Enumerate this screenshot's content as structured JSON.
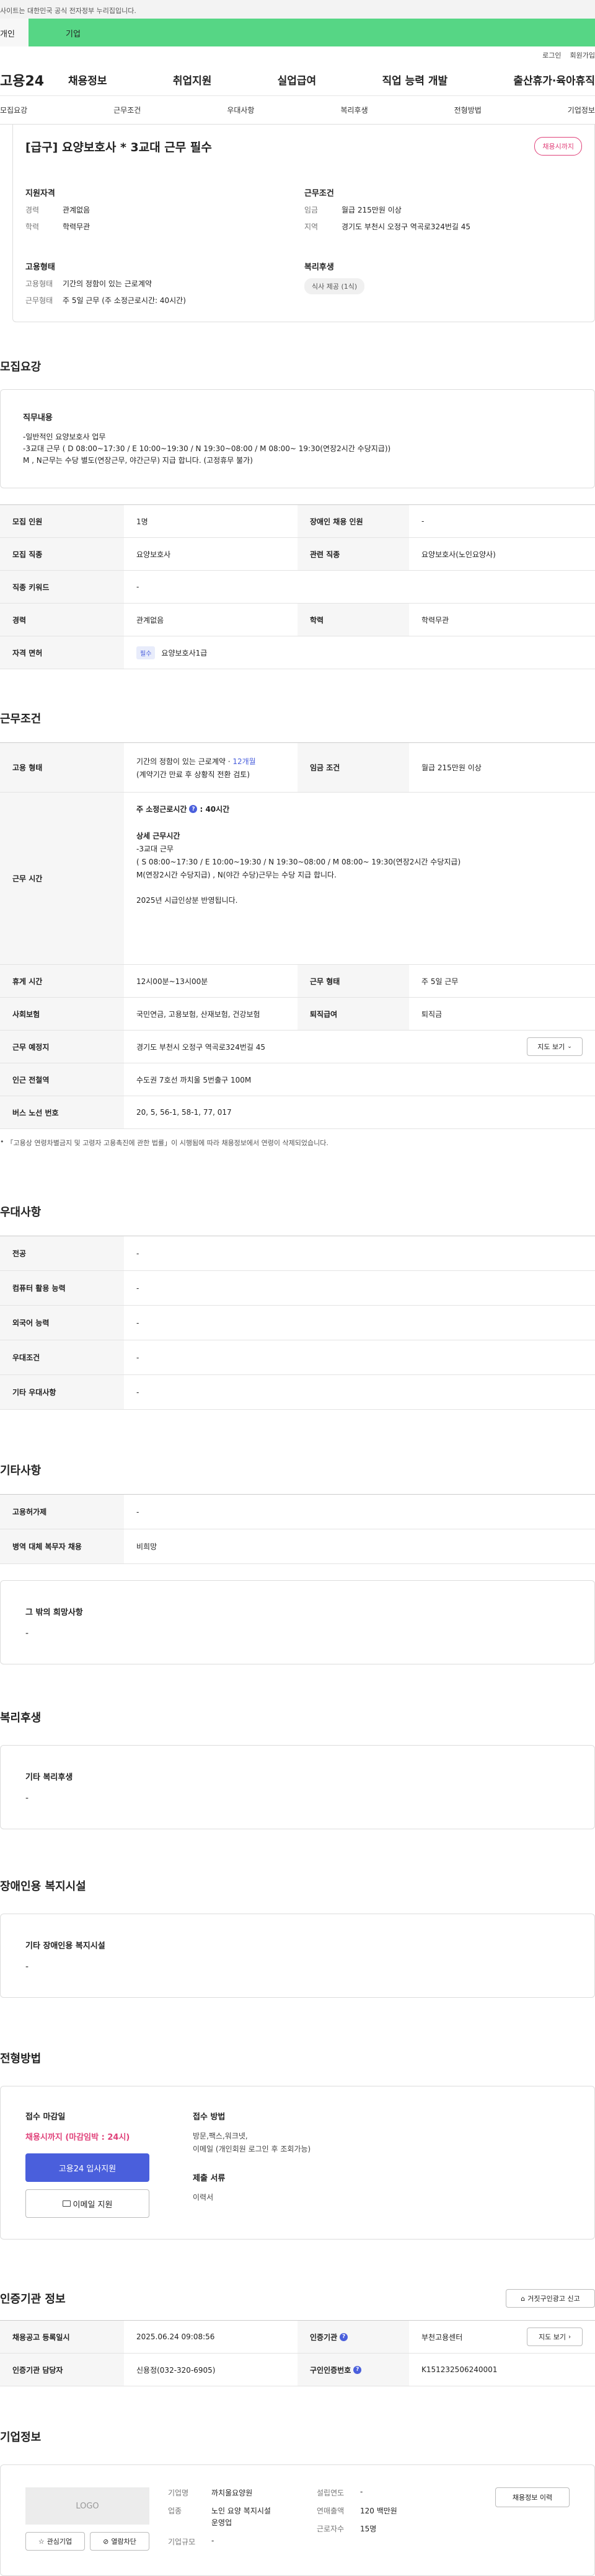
{
  "gov_notice": "사이트는 대한민국 공식 전자정부 누리집입니다.",
  "member_tabs": [
    "개인",
    "기업"
  ],
  "util_links": [
    "로그인",
    "회원가입"
  ],
  "logo": "고용24",
  "gnb": [
    "채용정보",
    "취업지원",
    "실업급여",
    "직업 능력 개발",
    "출산휴가·육아휴직"
  ],
  "anchors": [
    "모집요강",
    "근무조건",
    "우대사항",
    "복리후생",
    "전형방법",
    "기업정보"
  ],
  "summary": {
    "title": "[급구] 요양보호사 * 3교대 근무 필수",
    "badge": "채용시까지",
    "qual_title": "지원자격",
    "qual": [
      {
        "k": "경력",
        "v": "관계없음"
      },
      {
        "k": "학력",
        "v": "학력무관"
      }
    ],
    "cond_title": "근무조건",
    "cond": [
      {
        "k": "임금",
        "v": "월급 215만원 이상"
      },
      {
        "k": "지역",
        "v": "경기도 부천시 오정구 역곡로324번길 45"
      }
    ],
    "emp_title": "고용형태",
    "emp": [
      {
        "k": "고용형태",
        "v": "기간의 정함이 있는 근로계약"
      },
      {
        "k": "근무형태",
        "v": "주 5일 근무 (주 소정근로시간: 40시간)"
      }
    ],
    "welfare_title": "복리후생",
    "welfare_chip": "식사 제공 (1식)"
  },
  "recruit": {
    "title": "모집요강",
    "job_title": "직무내용",
    "job_lines": [
      "-일반적인 요양보호사 업무",
      "-3교대 근무 ( D 08:00~17:30 / E 10:00~19:30 / N 19:30~08:00 / M 08:00~ 19:30(연장2시간 수당지급))",
      "M , N근무는 수당 별도(연장근무, 야간근무) 지급 합니다. (고정휴무 불가)"
    ],
    "rows": [
      {
        "k1": "모집 인원",
        "v1": "1명",
        "k2": "장애인 채용 인원",
        "v2": "-"
      },
      {
        "k1": "모집 직종",
        "v1": "요양보호사",
        "k2": "관련 직종",
        "v2": "요양보호사(노인요양사)"
      },
      {
        "k1": "직종 키워드",
        "v1": "-",
        "k2": "",
        "v2": ""
      },
      {
        "k1": "경력",
        "v1": "관계없음",
        "k2": "학력",
        "v2": "학력무관"
      },
      {
        "k1": "자격 면허",
        "v1": "요양보호사1급",
        "k2": "",
        "v2": ""
      }
    ],
    "license_tag": "필수"
  },
  "work": {
    "title": "근무조건",
    "emp_k": "고용 형태",
    "emp_v1": "기간의 정함이 있는 근로계약 · ",
    "emp_v1_hl": "12개월",
    "emp_v2": "(계약기간 만료 후 상황직 전환 검토)",
    "wage_k": "임금 조건",
    "wage_v": "월급 215만원 이상",
    "time_k": "근무 시간",
    "time_a": "주 소정근로시간",
    "time_b": ": 40시간",
    "time_detail_title": "상세 근무시간",
    "time_lines": [
      "-3교대 근무",
      "( S 08:00~17:30 / E 10:00~19:30 / N 19:30~08:00 / M 08:00~ 19:30(연장2시간 수당지급)",
      " M(연장2시간 수당지급) , N(야간 수당)근무는 수당 지급 합니다."
    ],
    "time_note": "2025년 시급인상분 반영됩니다.",
    "rows": [
      {
        "k1": "휴게 시간",
        "v1": "12시00분~13시00분",
        "k2": "근무 형태",
        "v2": "주 5일 근무"
      },
      {
        "k1": "사회보험",
        "v1": "국민연금, 고용보험, 산재보험, 건강보험",
        "k2": "퇴직급여",
        "v2": "퇴직금"
      }
    ],
    "place_k": "근무 예정지",
    "place_v": "경기도 부천시 오정구 역곡로324번길 45",
    "map_btn": "지도 보기",
    "subway_k": "인근 전철역",
    "subway_v": "수도권 7호선 까치울 5번출구 100M",
    "bus_k": "버스 노선 번호",
    "bus_v": "20, 5, 56-1, 58-1, 77, 017",
    "footnote": "「고용상 연령차별금지 및 고령자 고용촉진에 관한 법률」이 시행됨에 따라 채용정보에서 연령이 삭제되었습니다."
  },
  "pref": {
    "title": "우대사항",
    "rows": [
      {
        "k": "전공",
        "v": "-"
      },
      {
        "k": "컴퓨터 활용 능력",
        "v": "-"
      },
      {
        "k": "외국어 능력",
        "v": "-"
      },
      {
        "k": "우대조건",
        "v": "-"
      },
      {
        "k": "기타 우대사항",
        "v": "-"
      }
    ]
  },
  "etc": {
    "title": "기타사항",
    "rows": [
      {
        "k": "고용허가제",
        "v": "-"
      },
      {
        "k": "병역 대체 복무자 채용",
        "v": "비희망"
      }
    ],
    "box_title": "그 밖의 희망사항",
    "box_v": "-"
  },
  "benefit": {
    "title": "복리후생",
    "box_title": "기타 복리후생",
    "box_v": "-"
  },
  "disabled": {
    "title": "장애인용 복지시설",
    "box_title": "기타 장애인용 복지시설",
    "box_v": "-"
  },
  "process": {
    "title": "전형방법",
    "deadline_title": "접수 마감일",
    "deadline_v": "채용시까지 (마감임박 : 24시)",
    "apply_btn": "고용24 입사지원",
    "email_btn": "이메일 지원",
    "method_title": "접수 방법",
    "method_v1": "방문,팩스,워크넷,",
    "method_v2": "이메일 (개인회원 로그인 후 조회가능)",
    "docs_title": "제출 서류",
    "docs_v": "이력서"
  },
  "agency": {
    "title": "인증기관 정보",
    "report_btn": "거짓구인광고 신고",
    "rows": [
      {
        "k1": "채용공고 등록일시",
        "v1": "2025.06.24 09:08:56",
        "k2": "인증기관",
        "v2": "부천고용센터"
      },
      {
        "k1": "인증기관 담당자",
        "v1": "신용정(032-320-6905)",
        "k2": "구인인증번호",
        "v2": "K151232506240001"
      }
    ],
    "map_btn": "지도 보기"
  },
  "company": {
    "title": "기업정보",
    "logo_text": "LOGO",
    "fav_btn": "관심기업",
    "block_btn": "열람차단",
    "info": [
      {
        "k": "기업명",
        "v": "까치울요양원"
      },
      {
        "k": "업종",
        "v": "노인 요양 복지시설 운영업"
      },
      {
        "k": "기업규모",
        "v": "-"
      }
    ],
    "info2": [
      {
        "k": "설립연도",
        "v": "-"
      },
      {
        "k": "연매출액",
        "v": "120 백만원"
      },
      {
        "k": "근로자수",
        "v": "15명"
      }
    ],
    "history_btn": "채용정보 이력"
  },
  "colors": {
    "green": "#56d685",
    "blue": "#4a5fdc",
    "pink": "#e0427a"
  }
}
